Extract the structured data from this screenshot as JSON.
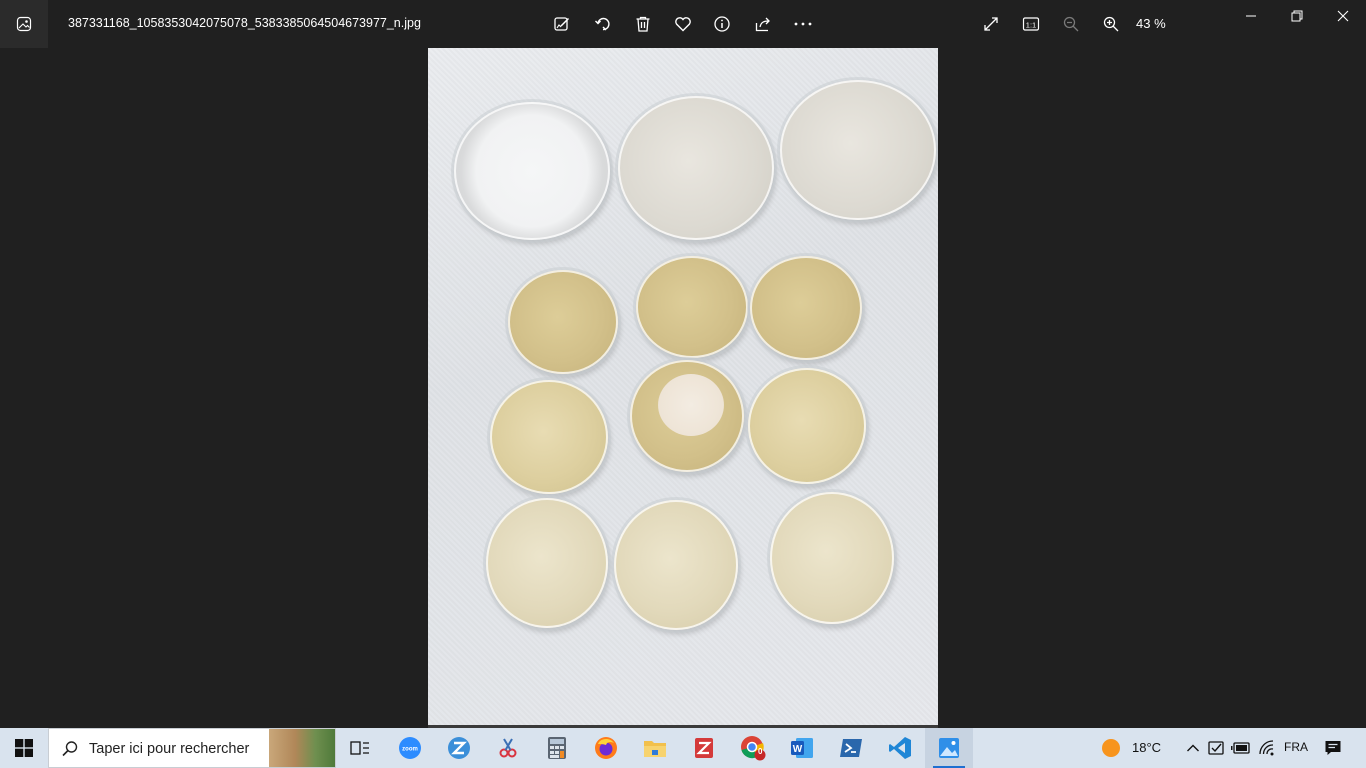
{
  "window": {
    "filename": "387331168_1058353042075078_5383385064504673977_n.jpg",
    "zoom_level": "43 %"
  },
  "toolbar": {
    "icons": [
      "edit-image-icon",
      "rotate-icon",
      "delete-icon",
      "favorite-icon",
      "info-icon",
      "share-icon",
      "more-icon"
    ],
    "view_icons": [
      "full-screen-icon",
      "actual-size-icon",
      "zoom-out-icon",
      "zoom-in-icon"
    ]
  },
  "taskbar": {
    "search_placeholder": "Taper ici pour rechercher",
    "apps": [
      "task-view",
      "zoom",
      "z-app",
      "snipping-tool",
      "calculator",
      "firefox",
      "file-explorer",
      "zotero",
      "chrome",
      "word",
      "powershell",
      "vscode",
      "photos"
    ],
    "chrome_badge": "0",
    "weather": "18°C",
    "language": "FRA",
    "colors": {
      "accent": "#1f6fd0",
      "taskbar_bg": "#d9e3ee"
    }
  }
}
